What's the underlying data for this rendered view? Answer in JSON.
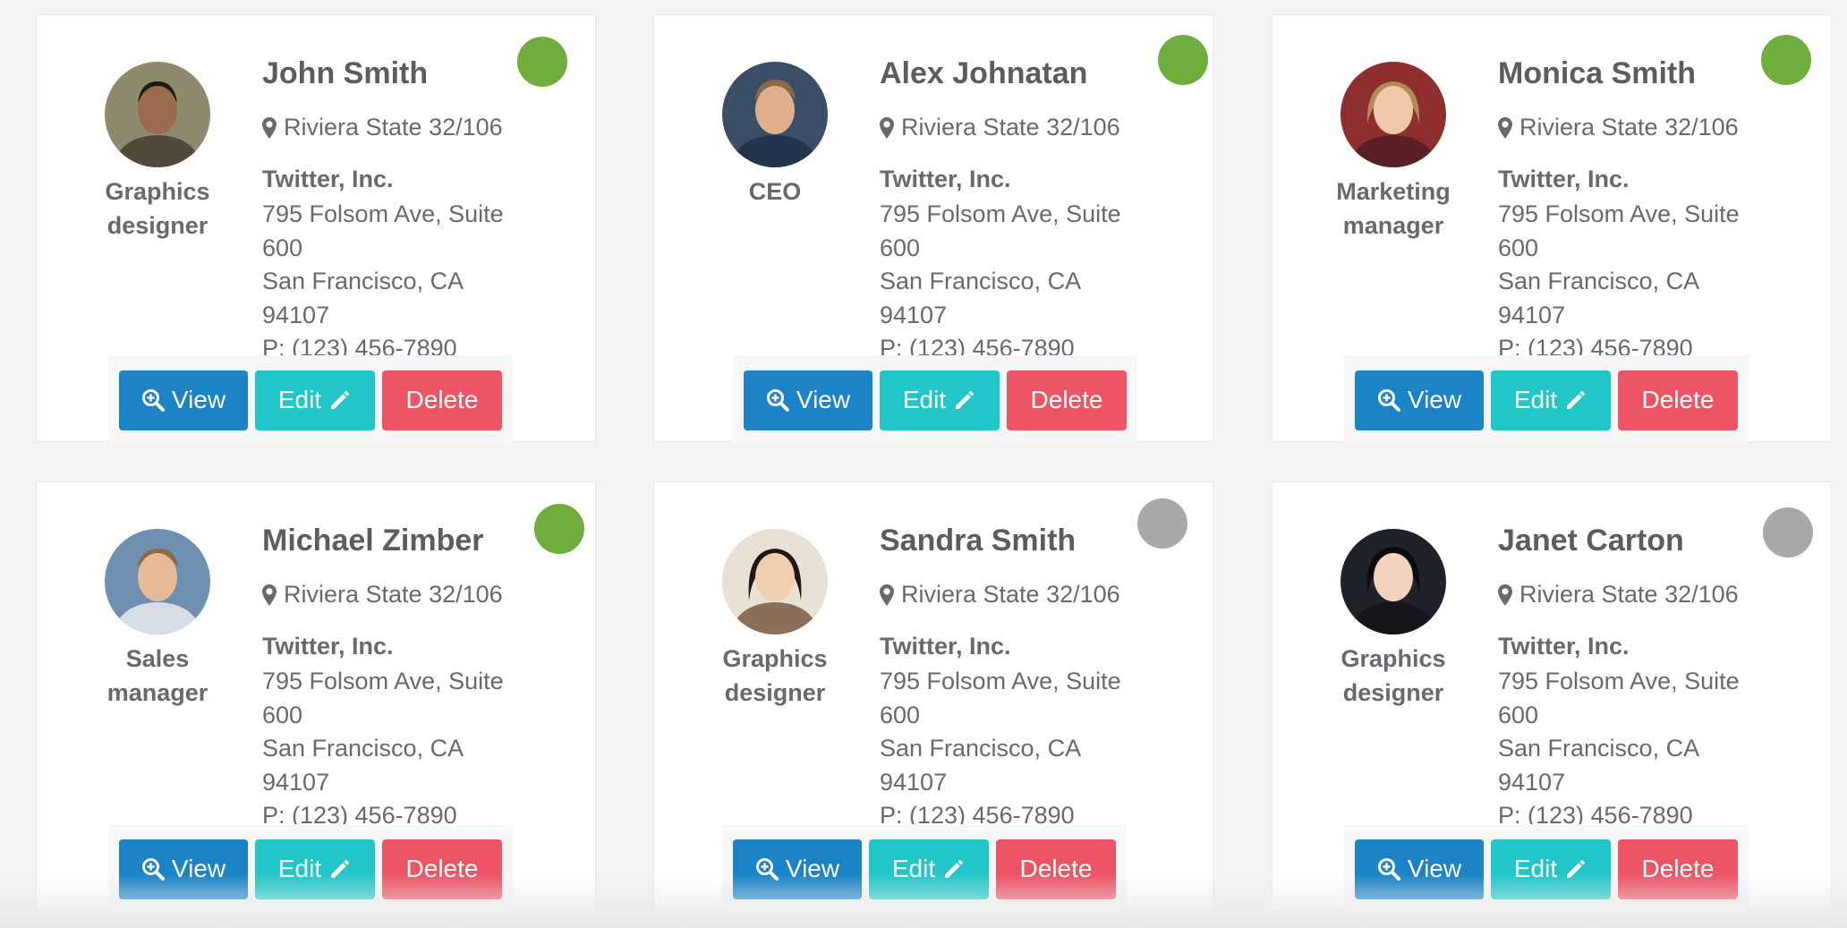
{
  "colors": {
    "online": "#6fae3d",
    "offline": "#aaa7a7",
    "view_button": "#1c84c6",
    "edit_button": "#23c6c8",
    "delete_button": "#ed5565"
  },
  "buttons": {
    "view_label": "View",
    "view_icon": "magnifier-plus-icon",
    "edit_label": "Edit",
    "edit_icon": "pencil-icon",
    "delete_label": "Delete"
  },
  "contacts": [
    {
      "name": "John Smith",
      "role_line1": "Graphics",
      "role_line2": "designer",
      "location": "Riviera State 32/106",
      "company": "Twitter, Inc.",
      "address_line1": "795 Folsom Ave, Suite",
      "address_line2": "600",
      "address_line3": "San Francisco, CA",
      "address_line4": "94107",
      "phone": "P: (123) 456-7890",
      "status": "online",
      "avatar_icon": "man-avatar-icon"
    },
    {
      "name": "Alex Johnatan",
      "role_line1": "CEO",
      "role_line2": "",
      "location": "Riviera State 32/106",
      "company": "Twitter, Inc.",
      "address_line1": "795 Folsom Ave, Suite",
      "address_line2": "600",
      "address_line3": "San Francisco, CA",
      "address_line4": "94107",
      "phone": "P: (123) 456-7890",
      "status": "online",
      "avatar_icon": "man-avatar-icon"
    },
    {
      "name": "Monica Smith",
      "role_line1": "Marketing",
      "role_line2": "manager",
      "location": "Riviera State 32/106",
      "company": "Twitter, Inc.",
      "address_line1": "795 Folsom Ave, Suite",
      "address_line2": "600",
      "address_line3": "San Francisco, CA",
      "address_line4": "94107",
      "phone": "P: (123) 456-7890",
      "status": "online",
      "avatar_icon": "woman-avatar-icon"
    },
    {
      "name": "Michael Zimber",
      "role_line1": "Sales",
      "role_line2": "manager",
      "location": "Riviera State 32/106",
      "company": "Twitter, Inc.",
      "address_line1": "795 Folsom Ave, Suite",
      "address_line2": "600",
      "address_line3": "San Francisco, CA",
      "address_line4": "94107",
      "phone": "P: (123) 456-7890",
      "status": "online",
      "avatar_icon": "man-avatar-icon"
    },
    {
      "name": "Sandra Smith",
      "role_line1": "Graphics",
      "role_line2": "designer",
      "location": "Riviera State 32/106",
      "company": "Twitter, Inc.",
      "address_line1": "795 Folsom Ave, Suite",
      "address_line2": "600",
      "address_line3": "San Francisco, CA",
      "address_line4": "94107",
      "phone": "P: (123) 456-7890",
      "status": "offline",
      "avatar_icon": "woman-avatar-icon"
    },
    {
      "name": "Janet Carton",
      "role_line1": "Graphics",
      "role_line2": "designer",
      "location": "Riviera State 32/106",
      "company": "Twitter, Inc.",
      "address_line1": "795 Folsom Ave, Suite",
      "address_line2": "600",
      "address_line3": "San Francisco, CA",
      "address_line4": "94107",
      "phone": "P: (123) 456-7890",
      "status": "offline",
      "avatar_icon": "woman-avatar-icon"
    }
  ]
}
